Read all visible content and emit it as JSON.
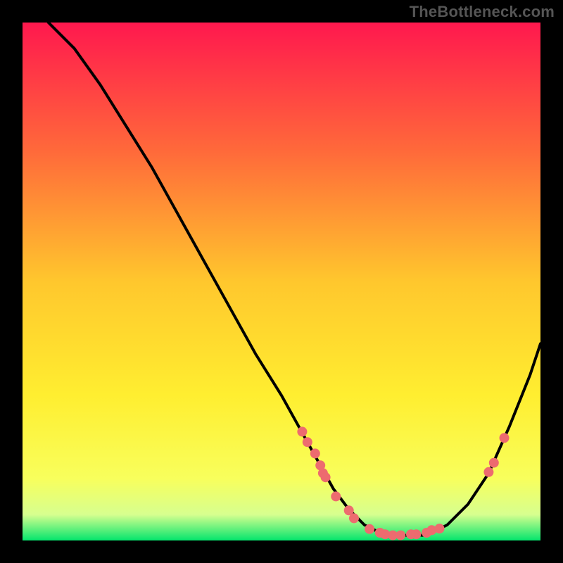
{
  "watermark": "TheBottleneck.com",
  "chart_data": {
    "type": "line",
    "title": "",
    "xlabel": "",
    "ylabel": "",
    "xlim": [
      0,
      100
    ],
    "ylim": [
      0,
      100
    ],
    "series": [
      {
        "name": "curve",
        "x": [
          5,
          10,
          15,
          20,
          25,
          30,
          35,
          40,
          45,
          50,
          55,
          60,
          63,
          66,
          70,
          74,
          78,
          82,
          86,
          90,
          94,
          98,
          100
        ],
        "y": [
          100,
          95,
          88,
          80,
          72,
          63,
          54,
          45,
          36,
          28,
          19,
          10,
          6,
          3,
          1,
          1,
          1,
          3,
          7,
          13,
          22,
          32,
          38
        ]
      }
    ],
    "points": [
      {
        "x": 54,
        "y": 21
      },
      {
        "x": 55,
        "y": 19
      },
      {
        "x": 56.5,
        "y": 16.8
      },
      {
        "x": 57.5,
        "y": 14.5
      },
      {
        "x": 58,
        "y": 13
      },
      {
        "x": 58.5,
        "y": 12.2
      },
      {
        "x": 60.5,
        "y": 8.5
      },
      {
        "x": 63,
        "y": 5.8
      },
      {
        "x": 64,
        "y": 4.3
      },
      {
        "x": 67,
        "y": 2.2
      },
      {
        "x": 69,
        "y": 1.5
      },
      {
        "x": 70,
        "y": 1.2
      },
      {
        "x": 71.5,
        "y": 1
      },
      {
        "x": 73,
        "y": 1
      },
      {
        "x": 75,
        "y": 1.2
      },
      {
        "x": 76,
        "y": 1.2
      },
      {
        "x": 78,
        "y": 1.5
      },
      {
        "x": 79,
        "y": 2
      },
      {
        "x": 80.5,
        "y": 2.3
      },
      {
        "x": 90,
        "y": 13.2
      },
      {
        "x": 91,
        "y": 15
      },
      {
        "x": 93,
        "y": 19.8
      }
    ],
    "background_gradient": {
      "type": "vertical",
      "stops": [
        {
          "offset": 0,
          "color": "#ff184e"
        },
        {
          "offset": 25,
          "color": "#ff6a3a"
        },
        {
          "offset": 50,
          "color": "#ffc72d"
        },
        {
          "offset": 72,
          "color": "#ffee30"
        },
        {
          "offset": 88,
          "color": "#f8ff5c"
        },
        {
          "offset": 95,
          "color": "#d7ff8f"
        },
        {
          "offset": 100,
          "color": "#04e56d"
        }
      ]
    }
  }
}
